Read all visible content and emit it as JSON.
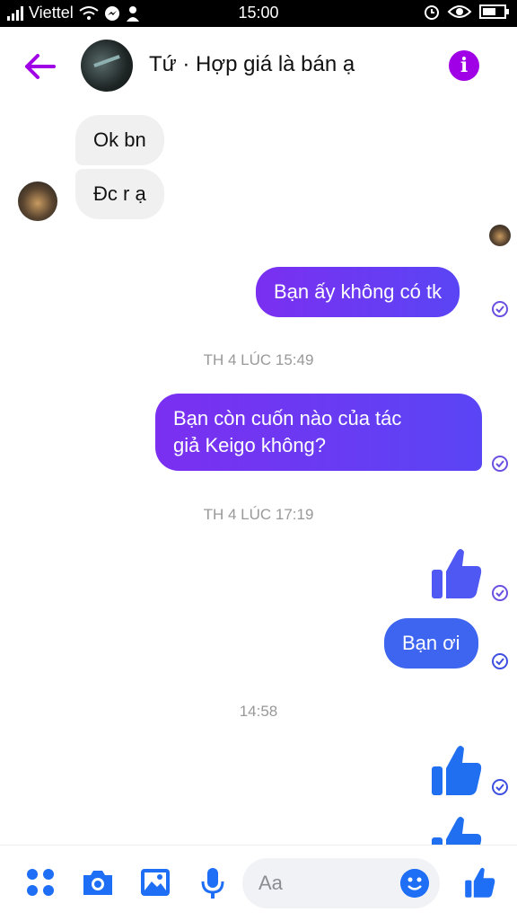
{
  "status_bar": {
    "carrier": "Viettel",
    "time": "15:00"
  },
  "header": {
    "title": "Tứ · Hợp giá là bán ạ"
  },
  "messages": {
    "in1": "Ok bn",
    "in2": "Đc r ạ",
    "out1": "Bạn ấy không có tk",
    "stamp1": "TH 4 LÚC 15:49",
    "out2_line1": "Bạn còn cuốn nào của  tác",
    "out2_line2": "giả Keigo không?",
    "stamp2": "TH 4 LÚC 17:19",
    "out3": "Bạn ơi",
    "stamp3": "14:58"
  },
  "composer": {
    "placeholder": "Aa"
  },
  "colors": {
    "accent": "#a000e6",
    "like_blue": "#3d65f0",
    "bubble_purple": "#7b2ff0"
  },
  "icons": [
    "back-arrow-icon",
    "info-icon",
    "menu-dots-icon",
    "camera-icon",
    "image-icon",
    "microphone-icon",
    "emoji-icon",
    "like-icon",
    "seen-check-icon"
  ]
}
